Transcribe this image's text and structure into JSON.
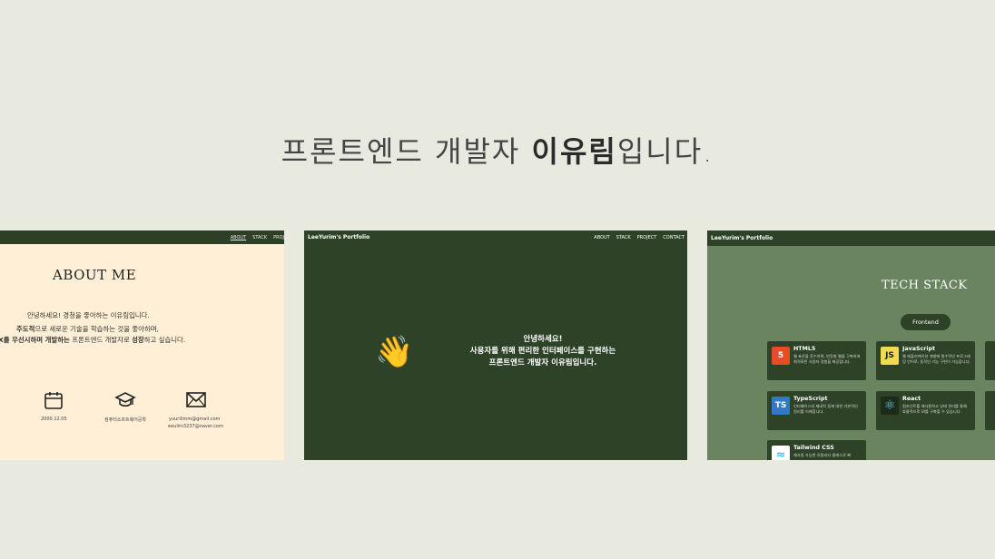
{
  "headline": {
    "prefix": "프론트엔드 개발자 ",
    "name": "이유림",
    "suffix": "입니다."
  },
  "about": {
    "nav": [
      "ABOUT",
      "STACK",
      "PROJ"
    ],
    "title": "ABOUT ME",
    "line1": "안녕하세요! 경청을 좋아하는 이유림입니다.",
    "line2_bold": "주도적",
    "line2_rest": "으로 새로운 기술을 학습하는 것을 좋아하며,",
    "line3_a": "X를 우선시하며 개발하는",
    "line3_b": " 프론트엔드 개발자로 ",
    "line3_c": "성장",
    "line3_d": "하고 싶습니다.",
    "birth": "2000.12.05",
    "school": "컴퓨터소프트웨어공학",
    "email1": "yuurilimm@gmail.com",
    "email2": "eeulim3237@naver.com"
  },
  "hero": {
    "brand": "LeeYurim's Portfolio",
    "nav": [
      "ABOUT",
      "STACK",
      "PROJECT",
      "CONTACT"
    ],
    "wave": "👋",
    "line1": "안녕하세요!",
    "line2": "사용자를 위해 편리한 인터페이스를 구현하는",
    "line3": "프론트엔드 개발자 이유림입니다."
  },
  "stack": {
    "brand": "LeeYurim's Portfolio",
    "title": "TECH STACK",
    "tab": "Frontend",
    "cards": [
      {
        "name": "HTML5",
        "desc": "웹 표준을 준수하며, 반응형 웹을 구축하여 최적화된 사용자 경험을 제공합니다.",
        "logo": "5",
        "color": "#e44d26",
        "icon": "html5-icon"
      },
      {
        "name": "JavaScript",
        "desc": "웹 애플리케이션 개발에 필수적인 프로그래밍 언어로, 동적인 기능 구현이 가능합니다.",
        "logo": "JS",
        "color": "#f0db4f",
        "icon": "javascript-icon"
      },
      {
        "name": "TypeScript",
        "desc": "인터페이스와 제네릭 등에 대한 기본적인 원리를 이해합니다.",
        "logo": "TS",
        "color": "#3178c6",
        "icon": "typescript-icon"
      },
      {
        "name": "React",
        "desc": "컴포넌트를 재사용하고 상태 관리를 통해 효율적으로 UI를 구축할 수 있습니다.",
        "logo": "⚛",
        "color": "#2e4227",
        "icon": "react-icon"
      },
      {
        "name": "Tailwind CSS",
        "desc": "재사용 가능한 유틸리티 클래스로 빠",
        "logo": "≈",
        "color": "#ffffff",
        "icon": "tailwind-icon"
      }
    ]
  }
}
